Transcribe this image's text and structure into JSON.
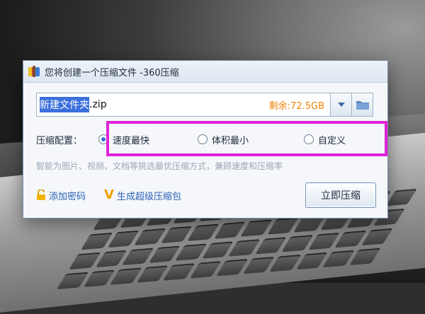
{
  "window": {
    "title": "您将创建一个压缩文件 -360压缩"
  },
  "path": {
    "filename_selected": "新建文件夹",
    "filename_ext": ".zip",
    "free_space": "剩余:72.5GB"
  },
  "compression": {
    "label": "压缩配置：",
    "options": [
      {
        "label": "速度最快",
        "checked": true
      },
      {
        "label": "体积最小",
        "checked": false
      },
      {
        "label": "自定义",
        "checked": false
      }
    ],
    "hint": "智能为图片、视频、文档等挑选最优压缩方式，兼顾速度和压缩率"
  },
  "actions": {
    "add_password": "添加密码",
    "super_package": "生成超级压缩包",
    "compress_now": "立即压缩"
  },
  "colors": {
    "highlight": "#e023d6",
    "free_space": "#f08300",
    "selection": "#3b6fdc",
    "link": "#2a63b8"
  }
}
